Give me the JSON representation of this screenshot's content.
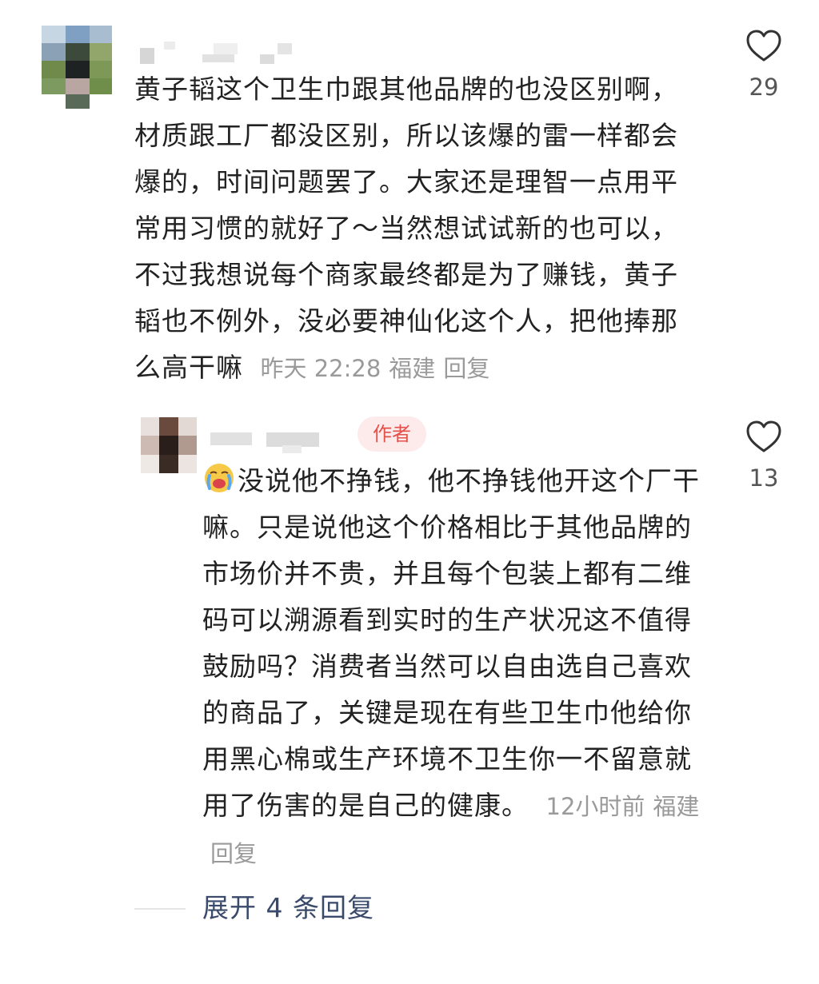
{
  "comment": {
    "text": "黄子韬这个卫生巾跟其他品牌的也没区别啊，材质跟工厂都没区别，所以该爆的雷一样都会爆的，时间问题罢了。大家还是理智一点用平常用习惯的就好了～当然想试试新的也可以，不过我想说每个商家最终都是为了赚钱，黄子韬也不例外，没必要神仙化这个人，把他捧那么高干嘛",
    "time": "昨天 22:28",
    "location": "福建",
    "reply_label": "回复",
    "like_count": "29",
    "like_icon": "heart-outline-icon"
  },
  "reply": {
    "badge": "作者",
    "emoji": "crying-face-emoji",
    "text": "没说他不挣钱，他不挣钱他开这个厂干嘛。只是说他这个价格相比于其他品牌的市场价并不贵，并且每个包装上都有二维码可以溯源看到实时的生产状况这不值得鼓励吗？消费者当然可以自由选自己喜欢的商品了，关键是现在有些卫生巾他给你用黑心棉或生产环境不卫生你一不留意就用了伤害的是自己的健康。",
    "time": "12小时前",
    "location": "福建",
    "reply_label": "回复",
    "like_count": "13",
    "like_icon": "heart-outline-icon"
  },
  "expand": {
    "label": "展开 4 条回复"
  },
  "colors": {
    "text": "#222222",
    "meta": "#9a9a9a",
    "badge_bg": "#fdeaea",
    "badge_text": "#e4504a",
    "expand_link": "#3a4a6b"
  }
}
